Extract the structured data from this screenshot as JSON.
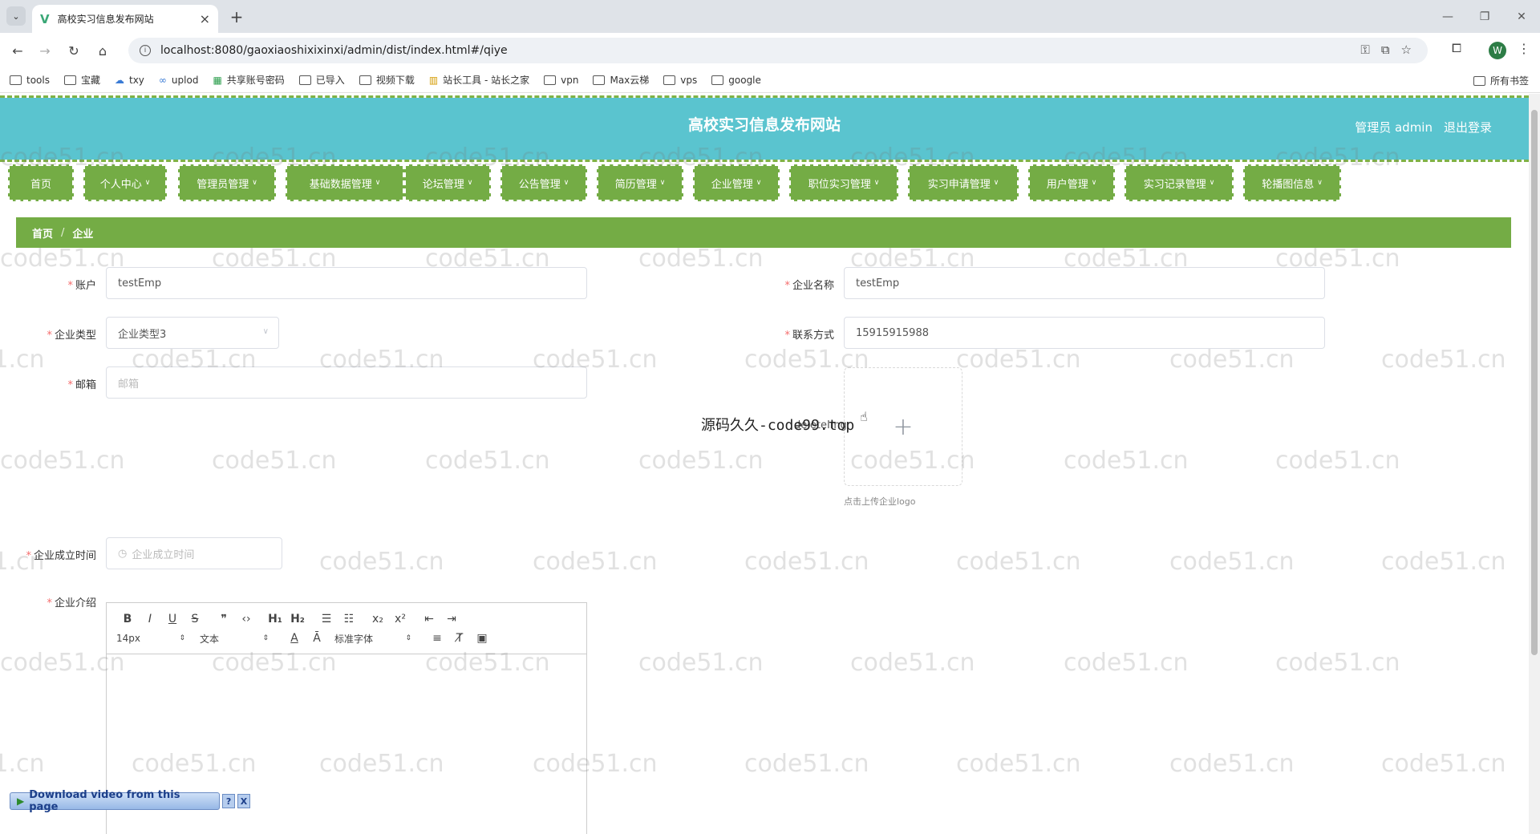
{
  "browser": {
    "tab_title": "高校实习信息发布网站",
    "tab_close": "×",
    "new_tab": "+",
    "url": "localhost:8080/gaoxiaoshixixinxi/admin/dist/index.html#/qiye",
    "profile_initial": "W",
    "bookmarks": [
      "tools",
      "宝藏",
      "txy",
      "uplod",
      "共享账号密码",
      "已导入",
      "视频下载",
      "站长工具 - 站长之家",
      "vpn",
      "Max云梯",
      "vps",
      "google"
    ],
    "all_bookmarks": "所有书签"
  },
  "header": {
    "title": "高校实习信息发布网站",
    "user": "管理员 admin",
    "logout": "退出登录"
  },
  "menu": [
    {
      "label": "首页",
      "caret": false
    },
    {
      "label": "个人中心",
      "caret": true
    },
    {
      "label": "管理员管理",
      "caret": true
    },
    {
      "label": "基础数据管理",
      "caret": true
    },
    {
      "label": "论坛管理",
      "caret": true
    },
    {
      "label": "公告管理",
      "caret": true
    },
    {
      "label": "简历管理",
      "caret": true
    },
    {
      "label": "企业管理",
      "caret": true
    },
    {
      "label": "职位实习管理",
      "caret": true
    },
    {
      "label": "实习申请管理",
      "caret": true
    },
    {
      "label": "用户管理",
      "caret": true
    },
    {
      "label": "实习记录管理",
      "caret": true
    },
    {
      "label": "轮播图信息",
      "caret": true
    }
  ],
  "breadcrumb": {
    "home": "首页",
    "sep": "/",
    "current": "企业"
  },
  "form": {
    "account": {
      "label": "账户",
      "value": "testEmp"
    },
    "company_name": {
      "label": "企业名称",
      "value": "testEmp"
    },
    "company_type": {
      "label": "企业类型",
      "value": "企业类型3"
    },
    "contact": {
      "label": "联系方式",
      "value": "15915915988"
    },
    "email": {
      "label": "邮箱",
      "placeholder": "邮箱"
    },
    "logo": {
      "alt": "deleteImg",
      "hint": "点击上传企业logo",
      "plus": "+"
    },
    "founded": {
      "label": "企业成立时间",
      "placeholder": "企业成立时间"
    },
    "intro": {
      "label": "企业介绍"
    }
  },
  "editor": {
    "font_size": "14px",
    "block": "文本",
    "font_family": "标准字体"
  },
  "overlay_text": "源码久久-code99.top",
  "download_bar": {
    "label": "Download video from this page",
    "help": "?",
    "close": "X"
  },
  "watermark_text": "code51.cn"
}
